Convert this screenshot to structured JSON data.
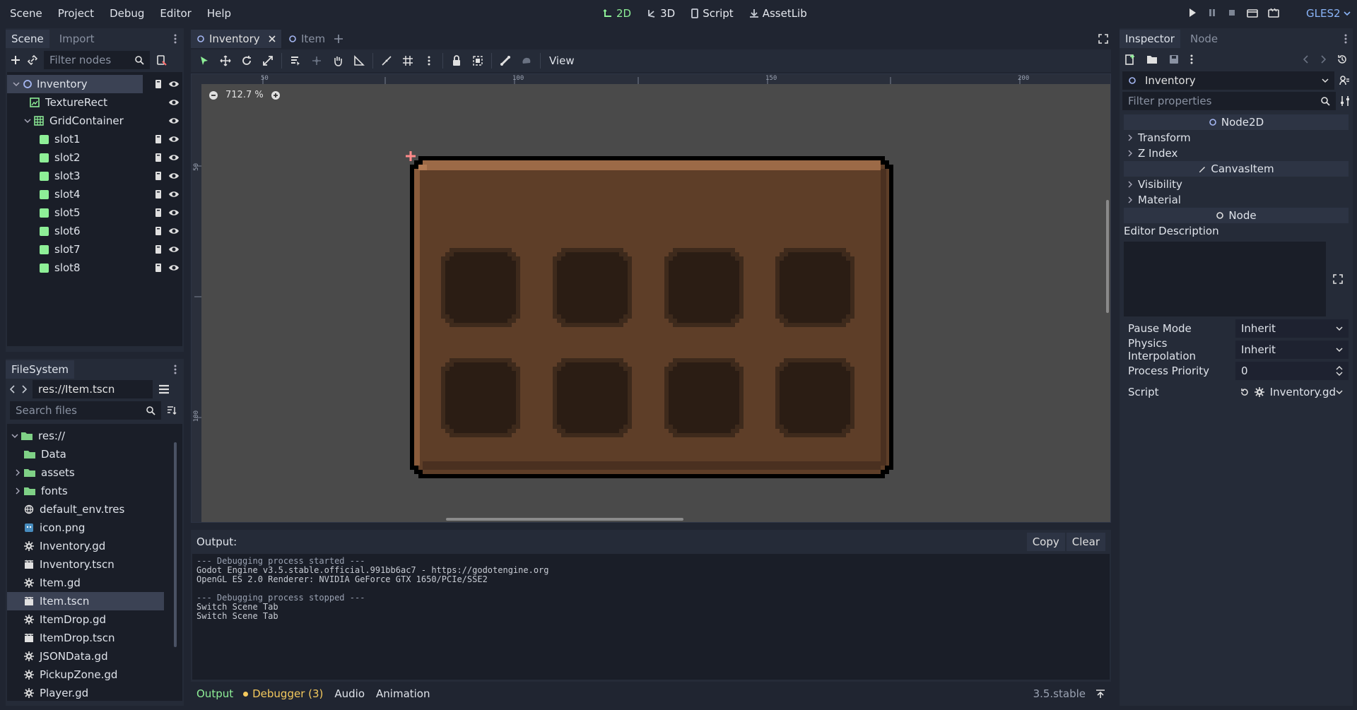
{
  "menu": [
    "Scene",
    "Project",
    "Debug",
    "Editor",
    "Help"
  ],
  "workspaces": [
    {
      "label": "2D",
      "icon": "2d-icon"
    },
    {
      "label": "3D",
      "icon": "3d-icon"
    },
    {
      "label": "Script",
      "icon": "script-icon"
    },
    {
      "label": "AssetLib",
      "icon": "assetlib-icon"
    }
  ],
  "renderer": "GLES2",
  "scene_dock": {
    "tabs": [
      "Scene",
      "Import"
    ],
    "filter_placeholder": "Filter nodes",
    "nodes": [
      {
        "label": "Inventory",
        "depth": 0,
        "type": "node2d"
      },
      {
        "label": "TextureRect",
        "depth": 1,
        "type": "texturerect"
      },
      {
        "label": "GridContainer",
        "depth": 1,
        "type": "grid"
      },
      {
        "label": "slot1",
        "depth": 2,
        "type": "slot"
      },
      {
        "label": "slot2",
        "depth": 2,
        "type": "slot"
      },
      {
        "label": "slot3",
        "depth": 2,
        "type": "slot"
      },
      {
        "label": "slot4",
        "depth": 2,
        "type": "slot"
      },
      {
        "label": "slot5",
        "depth": 2,
        "type": "slot"
      },
      {
        "label": "slot6",
        "depth": 2,
        "type": "slot"
      },
      {
        "label": "slot7",
        "depth": 2,
        "type": "slot"
      },
      {
        "label": "slot8",
        "depth": 2,
        "type": "slot"
      }
    ]
  },
  "filesystem": {
    "title": "FileSystem",
    "path": "res://Item.tscn",
    "search_placeholder": "Search files",
    "items": [
      {
        "label": "res://",
        "kind": "root"
      },
      {
        "label": "Data",
        "kind": "folder"
      },
      {
        "label": "assets",
        "kind": "folder-collapsed"
      },
      {
        "label": "fonts",
        "kind": "folder-collapsed"
      },
      {
        "label": "default_env.tres",
        "kind": "globe"
      },
      {
        "label": "icon.png",
        "kind": "image"
      },
      {
        "label": "Inventory.gd",
        "kind": "gear"
      },
      {
        "label": "Inventory.tscn",
        "kind": "scene"
      },
      {
        "label": "Item.gd",
        "kind": "gear"
      },
      {
        "label": "Item.tscn",
        "kind": "scene"
      },
      {
        "label": "ItemDrop.gd",
        "kind": "gear"
      },
      {
        "label": "ItemDrop.tscn",
        "kind": "scene"
      },
      {
        "label": "JSONData.gd",
        "kind": "gear"
      },
      {
        "label": "PickupZone.gd",
        "kind": "gear"
      },
      {
        "label": "Player.gd",
        "kind": "gear"
      }
    ],
    "selected": "Item.tscn"
  },
  "editor_tabs": [
    "Inventory",
    "Item"
  ],
  "viewport": {
    "zoom": "712.7 %",
    "view_label": "View",
    "ruler_top": [
      "50",
      "100",
      "150",
      "200"
    ],
    "ruler_left": [
      "50",
      "100"
    ]
  },
  "output": {
    "title": "Output:",
    "copy_label": "Copy",
    "clear_label": "Clear",
    "lines": [
      "--- Debugging process started ---",
      "Godot Engine v3.5.stable.official.991bb6ac7 - https://godotengine.org",
      "OpenGL ES 2.0 Renderer: NVIDIA GeForce GTX 1650/PCIe/SSE2",
      "",
      "--- Debugging process stopped ---",
      "Switch Scene Tab",
      "Switch Scene Tab"
    ]
  },
  "bottom_tabs": [
    "Output",
    "Debugger (3)",
    "Audio",
    "Animation"
  ],
  "version": "3.5.stable",
  "inspector": {
    "tabs": [
      "Inspector",
      "Node"
    ],
    "object": "Inventory",
    "filter_placeholder": "Filter properties",
    "section_node2d": "Node2D",
    "transform": "Transform",
    "zindex": "Z Index",
    "section_canvasitem": "CanvasItem",
    "visibility": "Visibility",
    "material": "Material",
    "section_node": "Node",
    "editor_description": "Editor Description",
    "props": [
      {
        "label": "Pause Mode",
        "value": "Inherit"
      },
      {
        "label": "Physics Interpolation",
        "value": "Inherit"
      },
      {
        "label": "Process Priority",
        "value": "0"
      },
      {
        "label": "Script",
        "value": "Inventory.gd"
      }
    ]
  },
  "colors": {
    "accent": "#8eef97",
    "panel_brown": "#5e3e28",
    "slot_dark": "#2b1d14"
  }
}
